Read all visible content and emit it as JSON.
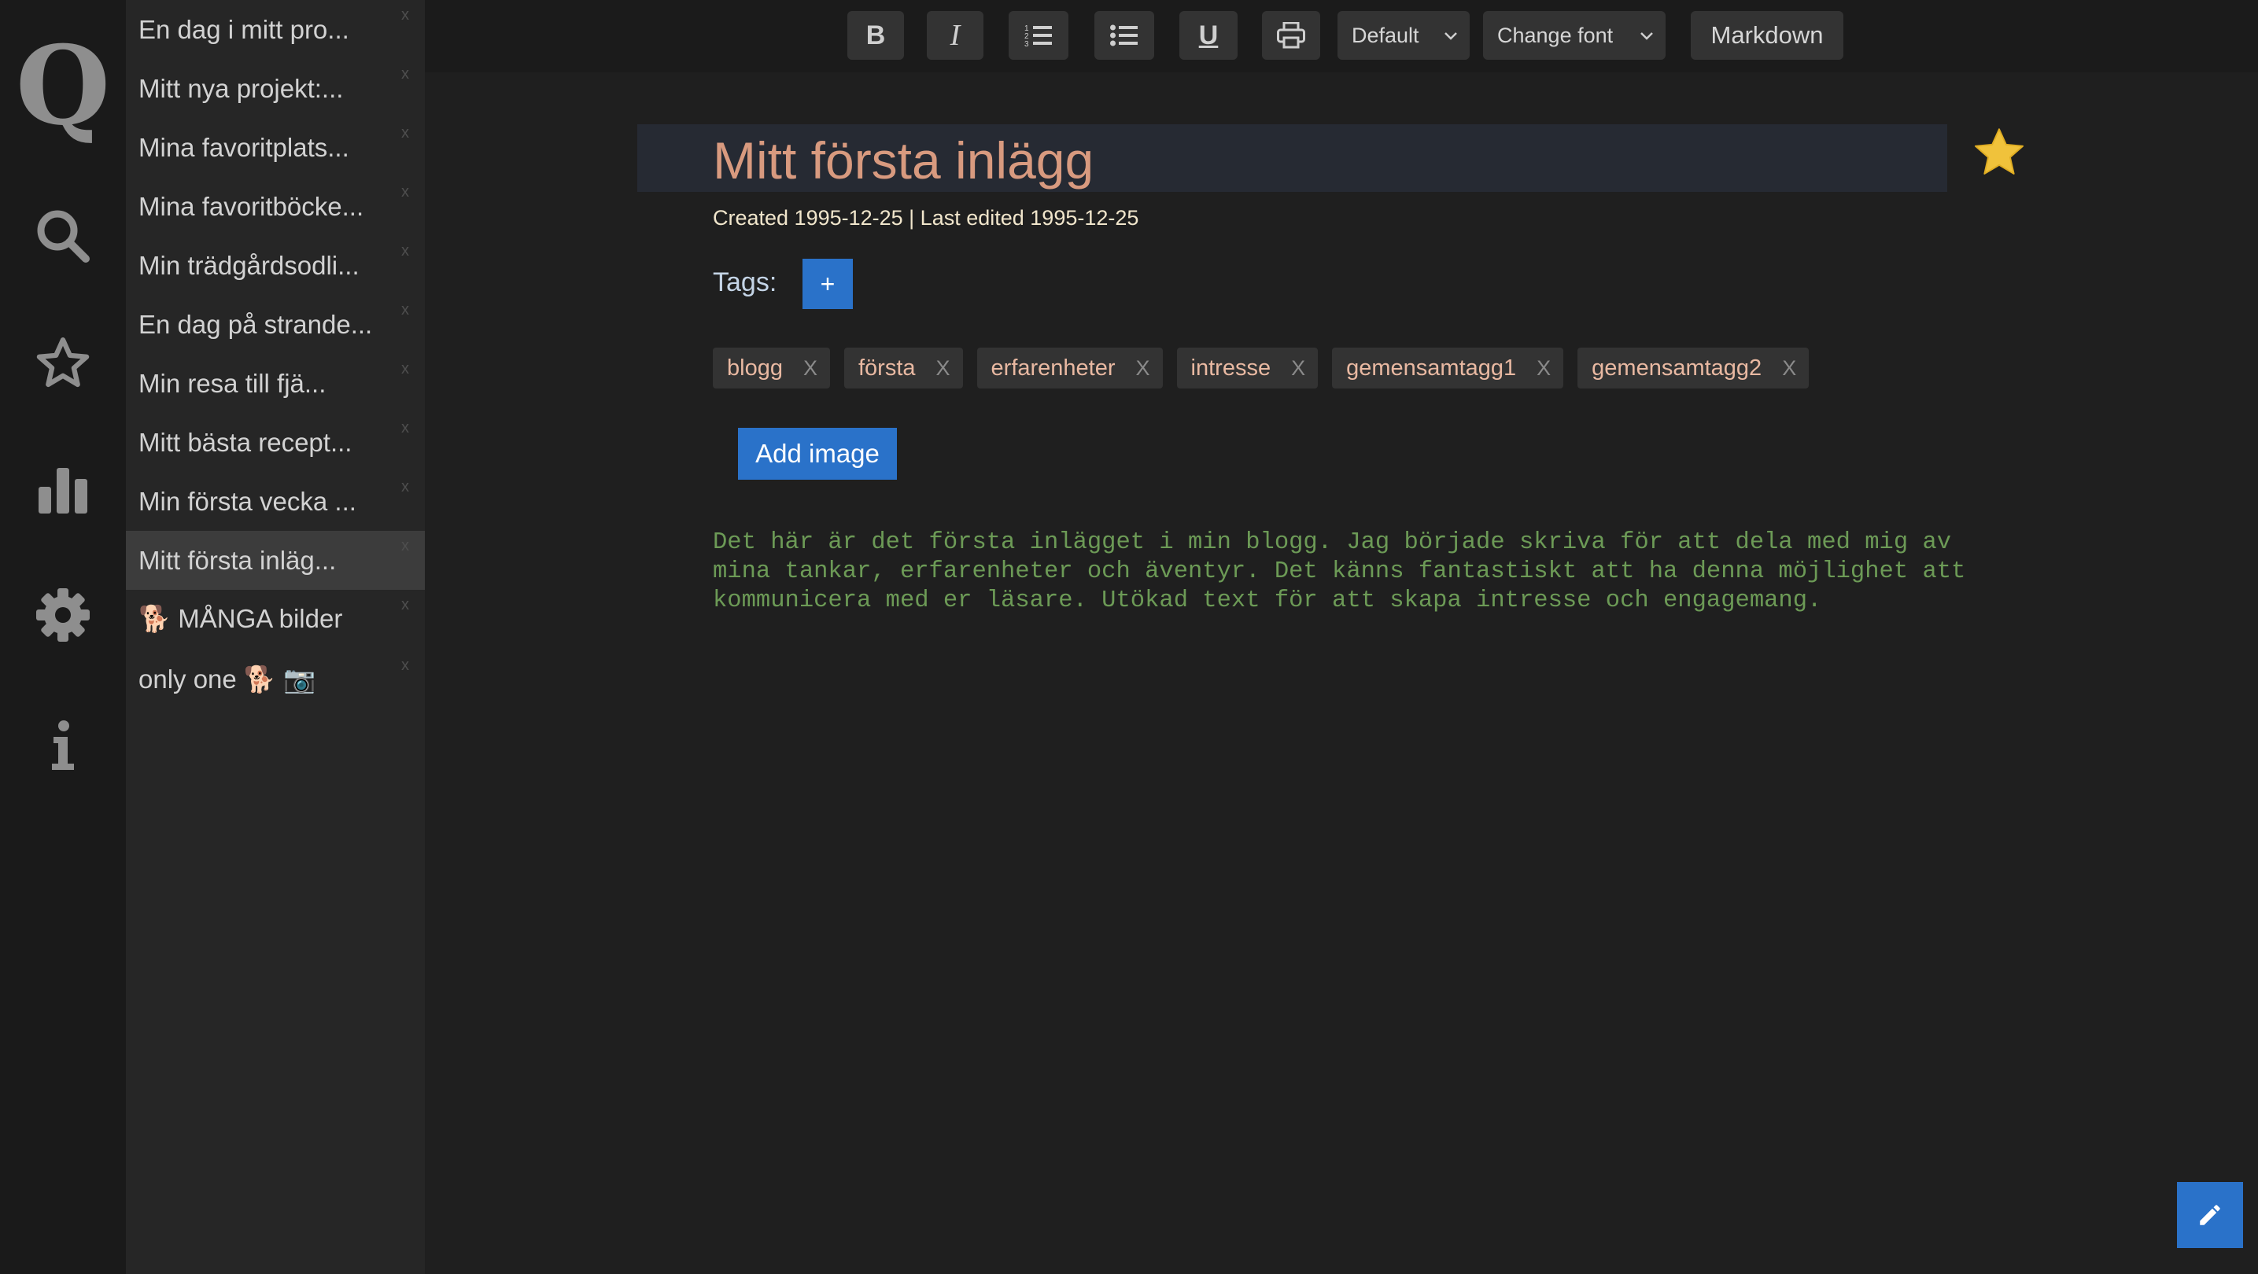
{
  "app": {
    "logo": "Q"
  },
  "rail": {
    "items": [
      {
        "icon": "search-icon"
      },
      {
        "icon": "star-icon"
      },
      {
        "icon": "bar-chart-icon"
      },
      {
        "icon": "gear-icon"
      },
      {
        "icon": "info-icon"
      }
    ]
  },
  "notes": [
    {
      "title": "En dag i mitt pro...",
      "close": "x"
    },
    {
      "title": "Mitt nya projekt:...",
      "close": "x"
    },
    {
      "title": "Mina favoritplats...",
      "close": "x"
    },
    {
      "title": "Mina favoritböcke...",
      "close": "x"
    },
    {
      "title": "Min trädgårdsodli...",
      "close": "x"
    },
    {
      "title": "En dag på strande...",
      "close": "x"
    },
    {
      "title": "Min resa till fjä...",
      "close": "x"
    },
    {
      "title": "Mitt bästa recept...",
      "close": "x"
    },
    {
      "title": "Min första vecka ...",
      "close": "x"
    },
    {
      "title": "Mitt första inläg...",
      "close": "x",
      "selected": true
    },
    {
      "title": "🐕 MÅNGA bilder",
      "close": "x"
    },
    {
      "title": "only one 🐕 📷",
      "close": "x"
    }
  ],
  "toolbar": {
    "bold": "B",
    "italic": "I",
    "ordered_list": "ordered-list-icon",
    "unordered_list": "unordered-list-icon",
    "underline": "U",
    "print": "printer-icon",
    "style_select": "Default",
    "font_select": "Change font",
    "markdown": "Markdown"
  },
  "editor": {
    "title": "Mitt första inlägg",
    "meta": "Created 1995-12-25 | Last edited 1995-12-25",
    "favorite": true,
    "tags_label": "Tags:",
    "add_tag": "+",
    "tags": [
      {
        "name": "blogg",
        "remove": "X"
      },
      {
        "name": "första",
        "remove": "X"
      },
      {
        "name": "erfarenheter",
        "remove": "X"
      },
      {
        "name": "intresse",
        "remove": "X"
      },
      {
        "name": "gemensamtagg1",
        "remove": "X"
      },
      {
        "name": "gemensamtagg2",
        "remove": "X"
      }
    ],
    "add_image": "Add image",
    "body": "Det här är det första inlägget i min blogg. Jag började skriva för att dela med mig av mina tankar, erfarenheter och äventyr. Det känns fantastiskt att ha denna möjlighet att kommunicera med er läsare. Utökad text för att skapa intresse och engagemang."
  },
  "fab": {
    "icon": "pencil-icon"
  },
  "colors": {
    "accent": "#2a72c9",
    "title": "#d89a7f",
    "body_text": "#6c9a56",
    "tag_text": "#e9b9a2",
    "star": "#f0c23b"
  }
}
